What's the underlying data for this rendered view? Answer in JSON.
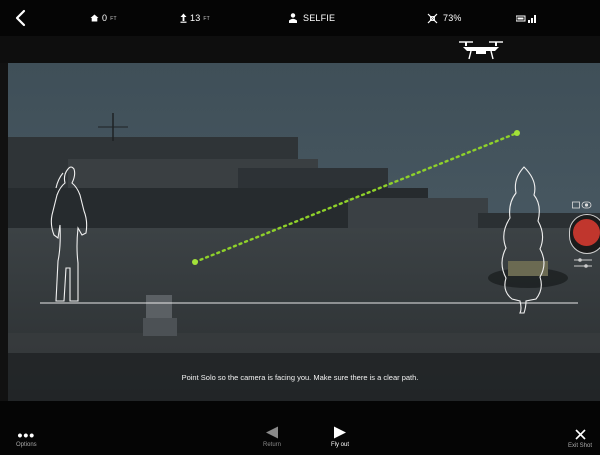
{
  "status_bar": {
    "home_distance": "0",
    "home_unit": "FT",
    "altitude": "13",
    "altitude_unit": "FT",
    "mode": "SELFIE",
    "battery": "73%"
  },
  "instruction": "Point Solo so the camera is facing you.  Make sure there is a clear path.",
  "bottom_bar": {
    "options_label": "Options",
    "return_label": "Return",
    "fly_out_label": "Fly out",
    "exit_label": "Exit Shot"
  },
  "colors": {
    "path_dots": "#8fd12a",
    "record": "#c0362d"
  },
  "icons": [
    "back-chevron-icon",
    "home-icon",
    "altitude-arrow-icon",
    "person-icon",
    "battery-drone-icon",
    "signal-icon",
    "drone-icon",
    "camera-settings-icon"
  ]
}
